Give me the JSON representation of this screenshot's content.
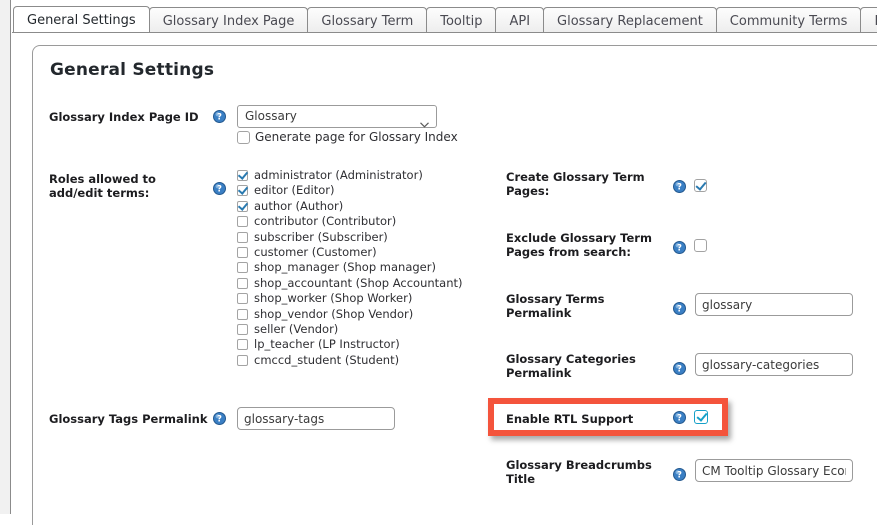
{
  "tabs": [
    {
      "label": "General Settings",
      "active": true
    },
    {
      "label": "Glossary Index Page",
      "active": false
    },
    {
      "label": "Glossary Term",
      "active": false
    },
    {
      "label": "Tooltip",
      "active": false
    },
    {
      "label": "API",
      "active": false
    },
    {
      "label": "Glossary Replacement",
      "active": false
    },
    {
      "label": "Community Terms",
      "active": false
    },
    {
      "label": "Ecommerce",
      "active": false
    }
  ],
  "panel": {
    "title": "General Settings"
  },
  "left_column": {
    "index_page": {
      "label": "Glossary Index Page ID",
      "select_value": "Glossary",
      "generate_checkbox_label": "Generate page for Glossary Index",
      "generate_checked": false
    },
    "roles": {
      "label_line1": "Roles allowed to",
      "label_line2": "add/edit terms:",
      "items": [
        {
          "label": "administrator (Administrator)",
          "checked": true
        },
        {
          "label": "editor (Editor)",
          "checked": true
        },
        {
          "label": "author (Author)",
          "checked": true
        },
        {
          "label": "contributor (Contributor)",
          "checked": false
        },
        {
          "label": "subscriber (Subscriber)",
          "checked": false
        },
        {
          "label": "customer (Customer)",
          "checked": false
        },
        {
          "label": "shop_manager (Shop manager)",
          "checked": false
        },
        {
          "label": "shop_accountant (Shop Accountant)",
          "checked": false
        },
        {
          "label": "shop_worker (Shop Worker)",
          "checked": false
        },
        {
          "label": "shop_vendor (Shop Vendor)",
          "checked": false
        },
        {
          "label": "seller (Vendor)",
          "checked": false
        },
        {
          "label": "lp_teacher (LP Instructor)",
          "checked": false
        },
        {
          "label": "cmccd_student (Student)",
          "checked": false
        }
      ]
    },
    "tags_permalink": {
      "label": "Glossary Tags Permalink",
      "value": "glossary-tags"
    }
  },
  "right_column": {
    "create_term_pages": {
      "label_line1": "Create Glossary Term",
      "label_line2": "Pages:",
      "checked": true
    },
    "exclude_from_search": {
      "label_line1": "Exclude Glossary Term",
      "label_line2": "Pages from search:",
      "checked": false
    },
    "terms_permalink": {
      "label_line1": "Glossary Terms",
      "label_line2": "Permalink",
      "value": "glossary"
    },
    "categories_permalink": {
      "label_line1": "Glossary Categories",
      "label_line2": "Permalink",
      "value": "glossary-categories"
    },
    "enable_rtl": {
      "label": "Enable RTL Support",
      "checked": true
    },
    "breadcrumbs_title": {
      "label_line1": "Glossary Breadcrumbs",
      "label_line2": "Title",
      "value": "CM Tooltip Glossary Ecommerce"
    }
  },
  "icons": {
    "help": "help-icon",
    "caret": "chevron-down-icon"
  },
  "colors": {
    "highlight_border": "#f4543c",
    "checkbox_accent": "#2a7ab0",
    "teal_accent": "#16a0c8",
    "help_icon_blue": "#2f6fb0"
  }
}
